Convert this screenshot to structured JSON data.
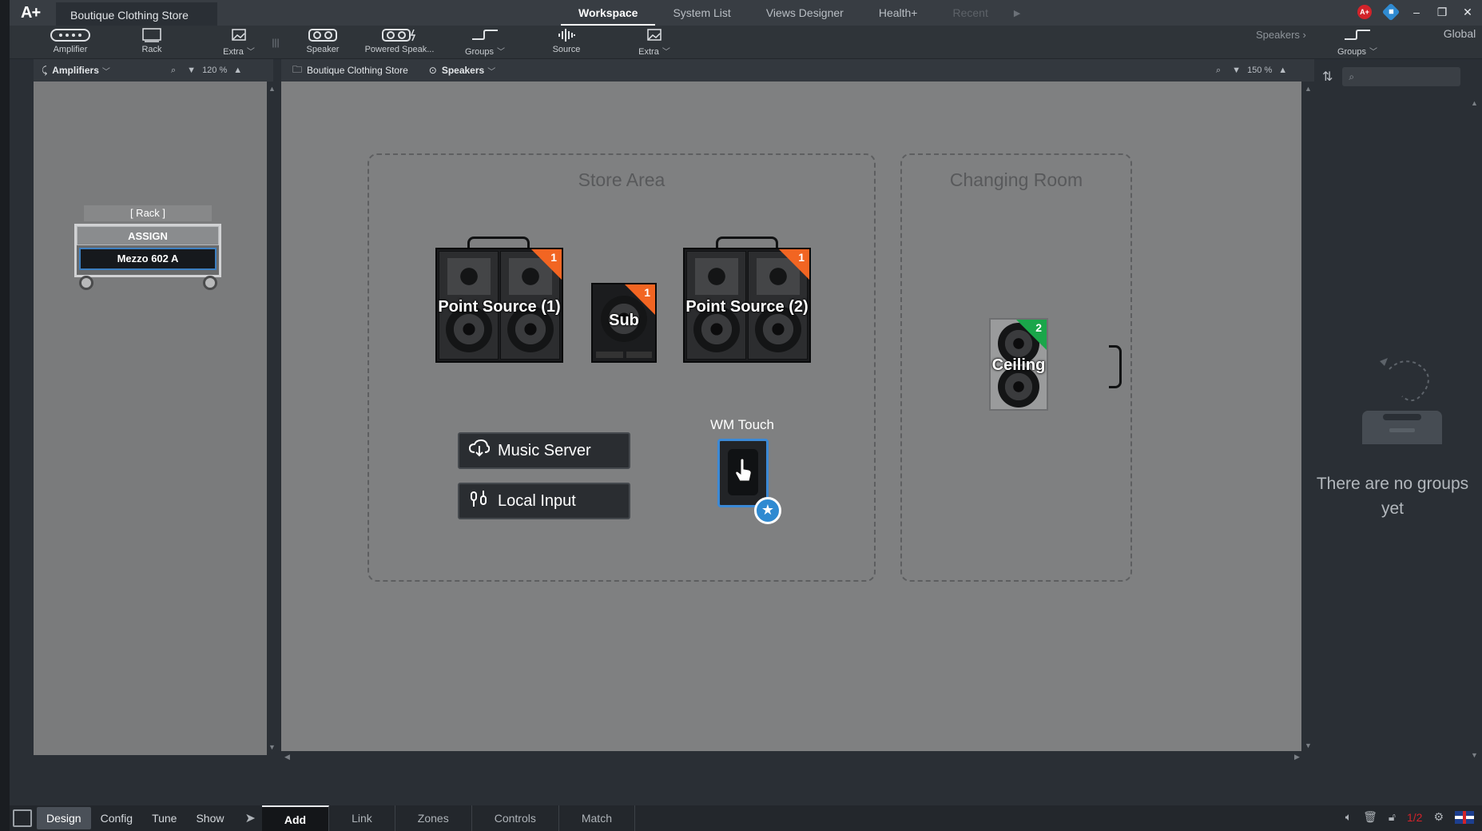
{
  "app": {
    "logo": "A+",
    "document_tab": "Boutique Clothing Store"
  },
  "top_tabs": [
    {
      "label": "Workspace",
      "state": "active"
    },
    {
      "label": "System List",
      "state": "normal"
    },
    {
      "label": "Views Designer",
      "state": "normal"
    },
    {
      "label": "Health+",
      "state": "normal"
    },
    {
      "label": "Recent",
      "state": "disabled"
    }
  ],
  "toolbar": {
    "amplifier": "Amplifier",
    "rack": "Rack",
    "extra_left": "Extra",
    "speaker": "Speaker",
    "powered_speaker": "Powered Speak...",
    "groups": "Groups",
    "source": "Source",
    "extra_right": "Extra",
    "speakers_nav": "Speakers",
    "groups_right": "Groups",
    "global": "Global"
  },
  "left_header": {
    "title": "Amplifiers",
    "zoom": "120 %"
  },
  "canvas_header": {
    "breadcrumb": "Boutique Clothing Store",
    "view": "Speakers",
    "zoom": "150 %"
  },
  "rack": {
    "label": "[ Rack ]",
    "assign": "ASSIGN",
    "device": "Mezzo 602 A"
  },
  "zones": {
    "store": {
      "title": "Store Area"
    },
    "changing": {
      "title": "Changing Room"
    }
  },
  "speakers": {
    "ps1": {
      "name": "Point Source (1)",
      "count": "1"
    },
    "sub": {
      "name": "Sub",
      "count": "1"
    },
    "ps2": {
      "name": "Point Source (2)",
      "count": "1"
    },
    "ceiling": {
      "name": "Ceiling",
      "count": "2"
    }
  },
  "sources": {
    "music_server": "Music Server",
    "local_input": "Local Input"
  },
  "wm_touch": {
    "label": "WM Touch"
  },
  "groups_panel": {
    "empty_message": "There are no groups yet"
  },
  "bottom": {
    "modes": [
      "Design",
      "Config",
      "Tune",
      "Show"
    ],
    "active_mode": "Design",
    "tabs": [
      "Add",
      "Link",
      "Zones",
      "Controls",
      "Match"
    ],
    "active_tab": "Add",
    "page_indicator": "1/2"
  },
  "colors": {
    "accent_blue": "#3b89d6",
    "count_orange": "#f26522",
    "count_green": "#1aa64a"
  }
}
